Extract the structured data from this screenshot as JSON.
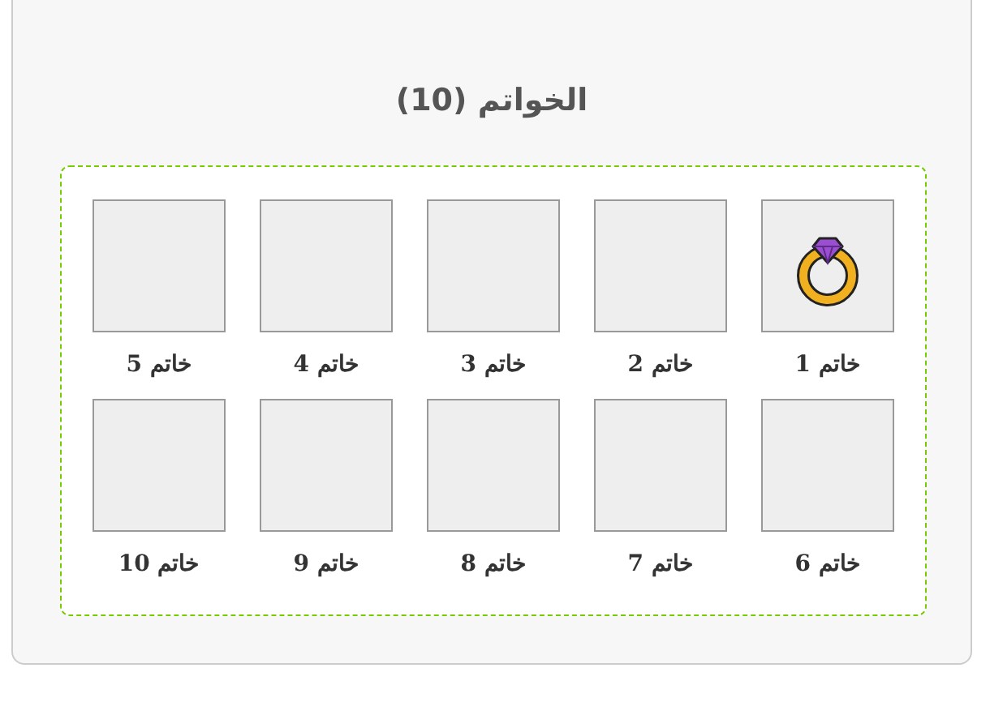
{
  "title": "الخواتم (10)",
  "items": [
    {
      "label": "خاتم 1",
      "kind": "ring"
    },
    {
      "label": "خاتم 2",
      "kind": "empty"
    },
    {
      "label": "خاتم 3",
      "kind": "empty"
    },
    {
      "label": "خاتم 4",
      "kind": "empty"
    },
    {
      "label": "خاتم 5",
      "kind": "empty"
    },
    {
      "label": "خاتم 6",
      "kind": "empty"
    },
    {
      "label": "خاتم 7",
      "kind": "empty"
    },
    {
      "label": "خاتم 8",
      "kind": "empty"
    },
    {
      "label": "خاتم 9",
      "kind": "empty"
    },
    {
      "label": "خاتم 10",
      "kind": "empty"
    }
  ]
}
